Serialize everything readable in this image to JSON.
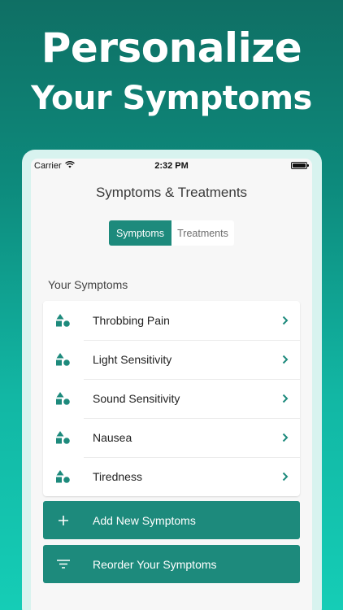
{
  "promo": {
    "headline_line1": "Personalize",
    "headline_line2": "Your Symptoms"
  },
  "status_bar": {
    "carrier": "Carrier",
    "time": "2:32 PM"
  },
  "nav": {
    "title": "Symptoms & Treatments"
  },
  "segmented_control": {
    "tabs": [
      {
        "label": "Symptoms",
        "selected": true
      },
      {
        "label": "Treatments",
        "selected": false
      }
    ]
  },
  "symptoms_section": {
    "label": "Your Symptoms",
    "items": [
      {
        "label": "Throbbing Pain",
        "icon": "shapes-icon"
      },
      {
        "label": "Light Sensitivity",
        "icon": "shapes-icon"
      },
      {
        "label": "Sound Sensitivity",
        "icon": "shapes-icon"
      },
      {
        "label": "Nausea",
        "icon": "shapes-icon"
      },
      {
        "label": "Tiredness",
        "icon": "shapes-icon"
      }
    ]
  },
  "actions": {
    "add_label": "Add New Symptoms",
    "reorder_label": "Reorder Your Symptoms"
  },
  "colors": {
    "accent": "#1d8a7c",
    "background_top": "#0f6f64",
    "background_bottom": "#15cdb6"
  }
}
